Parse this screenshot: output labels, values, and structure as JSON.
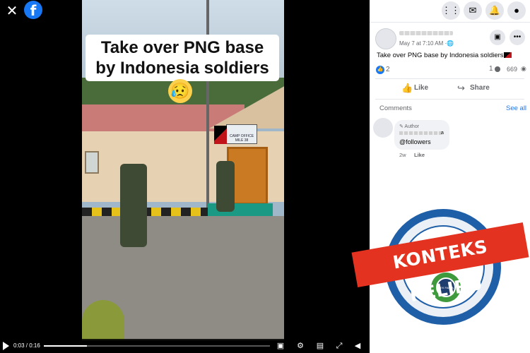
{
  "viewer": {
    "close_icon": "close-icon",
    "logo_letter": "f"
  },
  "video": {
    "caption": "Take over PNG base by Indonesia soldiers",
    "caption_emoji": "😥",
    "sign_text": "CAMP OFFICE MILE 38",
    "time": "0:03 / 0:16",
    "progress_fraction": 0.19
  },
  "topbar": {
    "icons": [
      "grid-menu-icon",
      "messenger-icon",
      "bell-icon",
      "account-avatar-icon"
    ]
  },
  "post": {
    "date": "May 7 at 7:10 AM ·",
    "globe": "🌐",
    "text": "Take over PNG base by Indonesia soldiers",
    "likes": "2",
    "comments": "1",
    "views": "669",
    "like_label": "Like",
    "share_label": "Share"
  },
  "comments": {
    "label": "Comments",
    "see_all": "See all",
    "author_badge": "✎ Author",
    "name_suffix": "a",
    "text": "@followers",
    "time": "2w",
    "like": "Like"
  },
  "stamp": {
    "label": "KONTEKS KELIRU",
    "logo_text": "CEK FAKTA",
    "colors": {
      "ring": "#1f5fa8",
      "banner": "#e3321f",
      "logo": "#3e9a3c"
    }
  }
}
